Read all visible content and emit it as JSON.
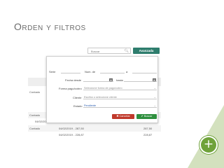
{
  "slide": {
    "title": "Orden y filtros"
  },
  "app": {
    "search_placeholder": "Buscar",
    "advanced_button": "Avanzada",
    "background_rows": [
      {
        "col1": "Contado",
        "col2": "",
        "col3": ""
      },
      {
        "col1": "Contado",
        "col2": "04/02/2019 - 45,00",
        "col3": "45,00"
      },
      {
        "col1": "Contado",
        "col2": "04/02/2019 - 287,50",
        "col3": "287,50"
      },
      {
        "col1": "",
        "col2": "04/02/2019 - 228,87",
        "col3": "228,87"
      }
    ]
  },
  "dialog": {
    "serie_label": "Serie",
    "num_de_label": "Num. de",
    "a_label": "a",
    "fecha_desde_label": "Fecha desde",
    "hasta_label": "hasta",
    "forma_pago_label": "Forma pago/cobro",
    "forma_pago_placeholder": "Seleccione forma de pago/cobro",
    "cliente_label": "Cliente",
    "cliente_placeholder": "Escriba o seleccione cliente",
    "estado_label": "Estado",
    "estado_value": "Pendiente",
    "cancel_button": "Cancelar",
    "search_button": "Buscar"
  },
  "colors": {
    "accent_green": "#2e8f3e",
    "cancel_red": "#c0392b",
    "teal_button": "#2e7d6d",
    "slide_green": "#6fa23a"
  },
  "icons": [
    "search-icon",
    "calendar-icon",
    "chevron-down-icon",
    "close-icon",
    "check-icon",
    "plus-icon"
  ]
}
